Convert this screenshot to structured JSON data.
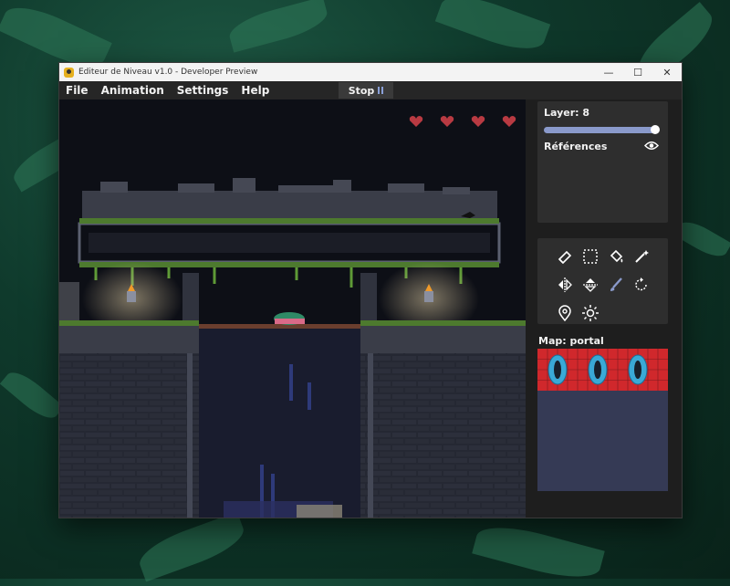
{
  "window": {
    "title": "Editeur de Niveau v1.0 - Developer Preview",
    "controls": [
      "—",
      "☐",
      "✕"
    ]
  },
  "menu": {
    "items": [
      "File",
      "Animation",
      "Settings",
      "Help"
    ],
    "stop_label": "Stop"
  },
  "game": {
    "hearts_count": 4
  },
  "sidebar": {
    "layer_label": "Layer: 8",
    "layer_slider_fraction": 1.0,
    "references_label": "Références",
    "tools": [
      "eraser-icon",
      "select-region-icon",
      "fill-bucket-icon",
      "magic-wand-icon",
      "flip-horizontal-icon",
      "flip-vertical-icon",
      "brush-icon",
      "rotate-icon",
      "location-pin-icon",
      "light-icon"
    ],
    "map_label": "Map: portal"
  },
  "colors": {
    "accent": "#8a9acb",
    "heart": "#b83a42",
    "map_bg": "#353a55",
    "tile_grid": "#d0282c"
  }
}
